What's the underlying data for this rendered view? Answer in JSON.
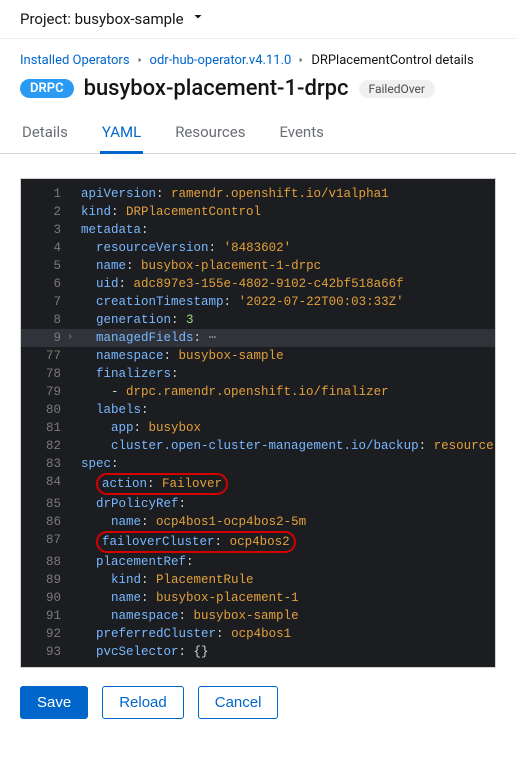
{
  "project": {
    "label": "Project: busybox-sample"
  },
  "breadcrumb": {
    "installed": "Installed Operators",
    "operator": "odr-hub-operator.v4.11.0",
    "current": "DRPlacementControl details"
  },
  "header": {
    "badge": "DRPC",
    "title": "busybox-placement-1-drpc",
    "status": "FailedOver"
  },
  "tabs": {
    "details": "Details",
    "yaml": "YAML",
    "resources": "Resources",
    "events": "Events"
  },
  "actions": {
    "save": "Save",
    "reload": "Reload",
    "cancel": "Cancel"
  },
  "yaml": {
    "apiVersion": {
      "k": "apiVersion",
      "v": "ramendr.openshift.io/v1alpha1"
    },
    "kind": {
      "k": "kind",
      "v": "DRPlacementControl"
    },
    "metadata": {
      "k": "metadata"
    },
    "resourceVersion": {
      "k": "resourceVersion",
      "v": "'8483602'"
    },
    "name": {
      "k": "name",
      "v": "busybox-placement-1-drpc"
    },
    "uid": {
      "k": "uid",
      "v": "adc897e3-155e-4802-9102-c42bf518a66f"
    },
    "creationTimestamp": {
      "k": "creationTimestamp",
      "v": "'2022-07-22T00:03:33Z'"
    },
    "generation": {
      "k": "generation",
      "v": "3"
    },
    "managedFields": {
      "k": "managedFields"
    },
    "namespace": {
      "k": "namespace",
      "v": "busybox-sample"
    },
    "finalizers": {
      "k": "finalizers"
    },
    "finalizerItem": "drpc.ramendr.openshift.io/finalizer",
    "labels": {
      "k": "labels"
    },
    "app": {
      "k": "app",
      "v": "busybox"
    },
    "backup": {
      "k": "cluster.open-cluster-management.io/backup",
      "v": "resource"
    },
    "spec": {
      "k": "spec"
    },
    "action": {
      "k": "action",
      "v": "Failover"
    },
    "drPolicyRef": {
      "k": "drPolicyRef"
    },
    "drPolicyName": {
      "k": "name",
      "v": "ocp4bos1-ocp4bos2-5m"
    },
    "failoverCluster": {
      "k": "failoverCluster",
      "v": "ocp4bos2"
    },
    "placementRef": {
      "k": "placementRef"
    },
    "placementKind": {
      "k": "kind",
      "v": "PlacementRule"
    },
    "placementName": {
      "k": "name",
      "v": "busybox-placement-1"
    },
    "placementNs": {
      "k": "namespace",
      "v": "busybox-sample"
    },
    "preferredCluster": {
      "k": "preferredCluster",
      "v": "ocp4bos1"
    },
    "pvcSelector": {
      "k": "pvcSelector",
      "v": "{}"
    }
  },
  "chart_data": null
}
